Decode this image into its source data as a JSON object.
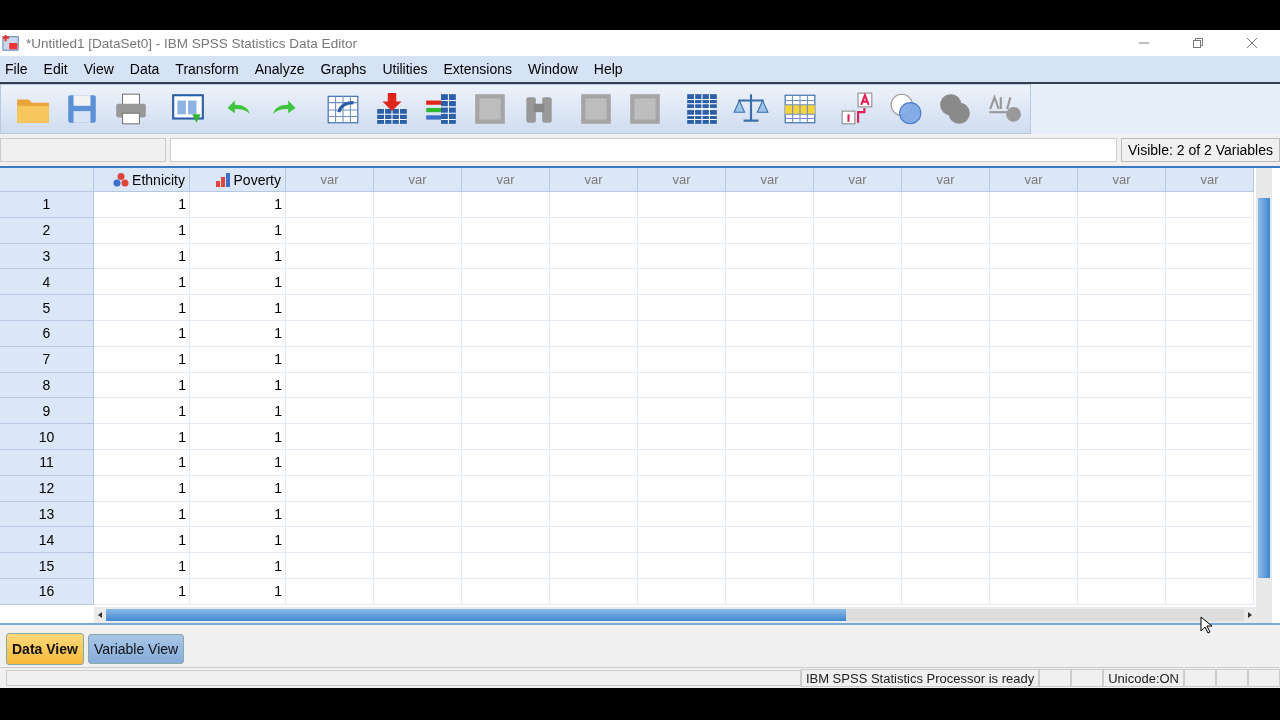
{
  "window": {
    "title": "*Untitled1 [DataSet0] - IBM SPSS Statistics Data Editor"
  },
  "menu": [
    "File",
    "Edit",
    "View",
    "Data",
    "Transform",
    "Analyze",
    "Graphs",
    "Utilities",
    "Extensions",
    "Window",
    "Help"
  ],
  "visible_info": "Visible: 2 of 2 Variables",
  "columns": [
    {
      "name": "Ethnicity",
      "kind": "nominal"
    },
    {
      "name": "Poverty",
      "kind": "ordinal"
    },
    {
      "name": "var",
      "kind": "empty"
    },
    {
      "name": "var",
      "kind": "empty"
    },
    {
      "name": "var",
      "kind": "empty"
    },
    {
      "name": "var",
      "kind": "empty"
    },
    {
      "name": "var",
      "kind": "empty"
    },
    {
      "name": "var",
      "kind": "empty"
    },
    {
      "name": "var",
      "kind": "empty"
    },
    {
      "name": "var",
      "kind": "empty"
    },
    {
      "name": "var",
      "kind": "empty"
    },
    {
      "name": "var",
      "kind": "empty"
    },
    {
      "name": "var",
      "kind": "empty"
    }
  ],
  "rows": [
    {
      "number": "1",
      "cells": [
        "1",
        "1"
      ]
    },
    {
      "number": "2",
      "cells": [
        "1",
        "1"
      ]
    },
    {
      "number": "3",
      "cells": [
        "1",
        "1"
      ]
    },
    {
      "number": "4",
      "cells": [
        "1",
        "1"
      ]
    },
    {
      "number": "5",
      "cells": [
        "1",
        "1"
      ]
    },
    {
      "number": "6",
      "cells": [
        "1",
        "1"
      ]
    },
    {
      "number": "7",
      "cells": [
        "1",
        "1"
      ]
    },
    {
      "number": "8",
      "cells": [
        "1",
        "1"
      ]
    },
    {
      "number": "9",
      "cells": [
        "1",
        "1"
      ]
    },
    {
      "number": "10",
      "cells": [
        "1",
        "1"
      ]
    },
    {
      "number": "11",
      "cells": [
        "1",
        "1"
      ]
    },
    {
      "number": "12",
      "cells": [
        "1",
        "1"
      ]
    },
    {
      "number": "13",
      "cells": [
        "1",
        "1"
      ]
    },
    {
      "number": "14",
      "cells": [
        "1",
        "1"
      ]
    },
    {
      "number": "15",
      "cells": [
        "1",
        "1"
      ]
    },
    {
      "number": "16",
      "cells": [
        "1",
        "1"
      ]
    }
  ],
  "tabs": [
    {
      "label": "Data View",
      "selected": true
    },
    {
      "label": "Variable View",
      "selected": false
    }
  ],
  "status_bar": {
    "message": "IBM SPSS Statistics Processor is ready",
    "unicode": "Unicode:ON"
  }
}
